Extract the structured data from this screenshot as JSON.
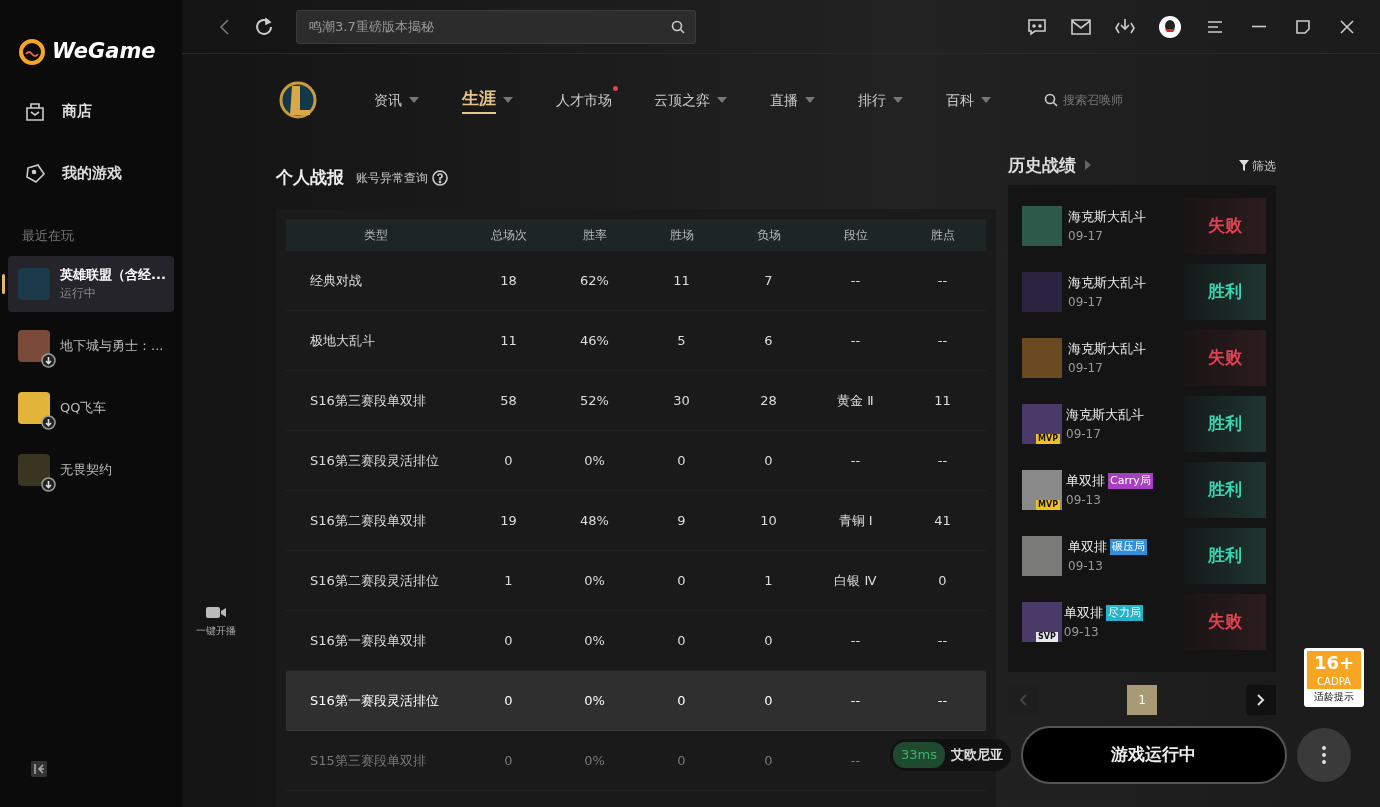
{
  "app": {
    "logo_text": "WeGame"
  },
  "sidebar": {
    "items": [
      {
        "label": "商店"
      },
      {
        "label": "我的游戏"
      }
    ],
    "recent_heading": "最近在玩",
    "recent": [
      {
        "name": "英雄联盟（含经...",
        "status": "运行中",
        "selected": true,
        "download": false
      },
      {
        "name": "地下城与勇士：...",
        "selected": false,
        "download": true
      },
      {
        "name": "QQ飞车",
        "selected": false,
        "download": true
      },
      {
        "name": "无畏契约",
        "selected": false,
        "download": true
      }
    ]
  },
  "topbar": {
    "search_placeholder": "鸣潮3.7重磅版本揭秘"
  },
  "game_nav": {
    "items": [
      {
        "label": "资讯",
        "selected": false,
        "has_menu": true,
        "dot": false
      },
      {
        "label": "生涯",
        "selected": true,
        "has_menu": true,
        "dot": false
      },
      {
        "label": "人才市场",
        "selected": false,
        "has_menu": false,
        "dot": true
      },
      {
        "label": "云顶之弈",
        "selected": false,
        "has_menu": true,
        "dot": false
      },
      {
        "label": "直播",
        "selected": false,
        "has_menu": true,
        "dot": false
      },
      {
        "label": "排行",
        "selected": false,
        "has_menu": true,
        "dot": false
      },
      {
        "label": "百科",
        "selected": false,
        "has_menu": true,
        "dot": false
      }
    ],
    "search_placeholder": "搜索召唤师"
  },
  "stats": {
    "title": "个人战报",
    "link": "账号异常查询",
    "columns": [
      "类型",
      "总场次",
      "胜率",
      "胜场",
      "负场",
      "段位",
      "胜点"
    ],
    "rows": [
      {
        "cells": [
          "经典对战",
          "18",
          "62%",
          "11",
          "7",
          "--",
          "--"
        ],
        "hovered": false,
        "faded": false
      },
      {
        "cells": [
          "极地大乱斗",
          "11",
          "46%",
          "5",
          "6",
          "--",
          "--"
        ],
        "hovered": false,
        "faded": false
      },
      {
        "cells": [
          "S16第三赛段单双排",
          "58",
          "52%",
          "30",
          "28",
          "黄金 Ⅱ",
          "11"
        ],
        "hovered": false,
        "faded": false
      },
      {
        "cells": [
          "S16第三赛段灵活排位",
          "0",
          "0%",
          "0",
          "0",
          "--",
          "--"
        ],
        "hovered": false,
        "faded": false
      },
      {
        "cells": [
          "S16第二赛段单双排",
          "19",
          "48%",
          "9",
          "10",
          "青铜 Ⅰ",
          "41"
        ],
        "hovered": false,
        "faded": false
      },
      {
        "cells": [
          "S16第二赛段灵活排位",
          "1",
          "0%",
          "0",
          "1",
          "白银 Ⅳ",
          "0"
        ],
        "hovered": false,
        "faded": false
      },
      {
        "cells": [
          "S16第一赛段单双排",
          "0",
          "0%",
          "0",
          "0",
          "--",
          "--"
        ],
        "hovered": false,
        "faded": false
      },
      {
        "cells": [
          "S16第一赛段灵活排位",
          "0",
          "0%",
          "0",
          "0",
          "--",
          "--"
        ],
        "hovered": true,
        "faded": false
      },
      {
        "cells": [
          "S15第三赛段单双排",
          "0",
          "0%",
          "0",
          "0",
          "--"
        ],
        "hovered": false,
        "faded": true
      }
    ]
  },
  "live_button": {
    "label": "一键开播"
  },
  "history": {
    "title": "历史战绩",
    "filter": "筛选",
    "matches": [
      {
        "mode": "海克斯大乱斗",
        "date": "09-17",
        "result": "失败",
        "kind": "loss"
      },
      {
        "mode": "海克斯大乱斗",
        "date": "09-17",
        "result": "胜利",
        "kind": "win"
      },
      {
        "mode": "海克斯大乱斗",
        "date": "09-17",
        "result": "失败",
        "kind": "loss"
      },
      {
        "mode": "海克斯大乱斗",
        "date": "09-17",
        "result": "胜利",
        "kind": "win",
        "badge": "MVP"
      },
      {
        "mode": "单双排",
        "tag": {
          "label": "Carry局",
          "color": "#a83fc0"
        },
        "date": "09-13",
        "result": "胜利",
        "kind": "win",
        "badge": "MVP"
      },
      {
        "mode": "单双排",
        "tag": {
          "label": "碾压局",
          "color": "#2f8fd8"
        },
        "date": "09-13",
        "result": "胜利",
        "kind": "win"
      },
      {
        "mode": "单双排",
        "tag": {
          "label": "尽力局",
          "color": "#26b3c9"
        },
        "date": "09-13",
        "result": "失败",
        "kind": "loss",
        "badge": "SVP"
      }
    ],
    "pager": {
      "prev_disabled": true,
      "pages": [
        {
          "label": "1",
          "selected": true
        }
      ]
    }
  },
  "age_rating": {
    "rating": "16+",
    "org": "CADPA",
    "caption": "适龄提示"
  },
  "launch": {
    "ping": "33ms",
    "server": "艾欧尼亚",
    "button": "游戏运行中"
  }
}
